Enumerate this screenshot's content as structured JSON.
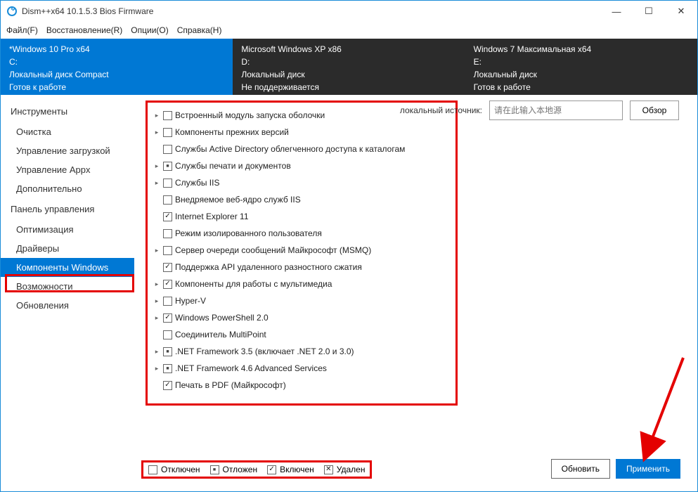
{
  "window": {
    "title": "Dism++x64 10.1.5.3 Bios Firmware"
  },
  "menu": {
    "file": "Файл(F)",
    "restore": "Восстановление(R)",
    "options": "Опции(O)",
    "help": "Справка(H)"
  },
  "os": {
    "c1l1": "*Windows 10 Pro x64",
    "c1l2": "C:",
    "c1l3": "Локальный диск Compact",
    "c1l4": "Готов к работе",
    "c2l1": "Microsoft Windows XP x86",
    "c2l2": "D:",
    "c2l3": "Локальный диск",
    "c2l4": "Не поддерживается",
    "c3l1": "Windows 7 Максимальная x64",
    "c3l2": "E:",
    "c3l3": "Локальный диск",
    "c3l4": "Готов к работе"
  },
  "sidebar": {
    "h1": "Инструменты",
    "i1": "Очистка",
    "i2": "Управление загрузкой",
    "i3": "Управление Appx",
    "i4": "Дополнительно",
    "h2": "Панель управления",
    "i5": "Оптимизация",
    "i6": "Драйверы",
    "i7": "Компоненты Windows",
    "i8": "Возможности",
    "i9": "Обновления"
  },
  "source": {
    "label": "локальный источник:",
    "placeholder": "请在此输入本地源",
    "browse": "Обзор"
  },
  "features": [
    {
      "exp": "▸",
      "state": "",
      "label": "Встроенный модуль запуска оболочки"
    },
    {
      "exp": "▸",
      "state": "",
      "label": "Компоненты прежних версий"
    },
    {
      "exp": "",
      "state": "",
      "label": "Службы Active Directory облегченного доступа к каталогам"
    },
    {
      "exp": "▸",
      "state": "mixed",
      "label": "Службы печати и документов"
    },
    {
      "exp": "▸",
      "state": "",
      "label": "Службы IIS"
    },
    {
      "exp": "",
      "state": "",
      "label": "Внедряемое веб-ядро служб IIS"
    },
    {
      "exp": "",
      "state": "checked",
      "label": "Internet Explorer 11"
    },
    {
      "exp": "",
      "state": "",
      "label": "Режим изолированного пользователя"
    },
    {
      "exp": "▸",
      "state": "",
      "label": "Сервер очереди сообщений Майкрософт (MSMQ)"
    },
    {
      "exp": "",
      "state": "checked",
      "label": "Поддержка API удаленного разностного сжатия"
    },
    {
      "exp": "▸",
      "state": "checked",
      "label": "Компоненты для работы с мультимедиа"
    },
    {
      "exp": "▸",
      "state": "",
      "label": "Hyper-V"
    },
    {
      "exp": "▸",
      "state": "checked",
      "label": "Windows PowerShell 2.0"
    },
    {
      "exp": "",
      "state": "",
      "label": "Соединитель MultiPoint"
    },
    {
      "exp": "▸",
      "state": "mixed",
      "label": ".NET Framework 3.5 (включает .NET 2.0 и 3.0)"
    },
    {
      "exp": "▸",
      "state": "mixed",
      "label": ".NET Framework 4.6 Advanced Services"
    },
    {
      "exp": "",
      "state": "checked",
      "label": "Печать в PDF (Майкрософт)"
    }
  ],
  "legend": {
    "off": "Отключен",
    "defer": "Отложен",
    "on": "Включен",
    "del": "Удален"
  },
  "actions": {
    "refresh": "Обновить",
    "apply": "Применить"
  }
}
